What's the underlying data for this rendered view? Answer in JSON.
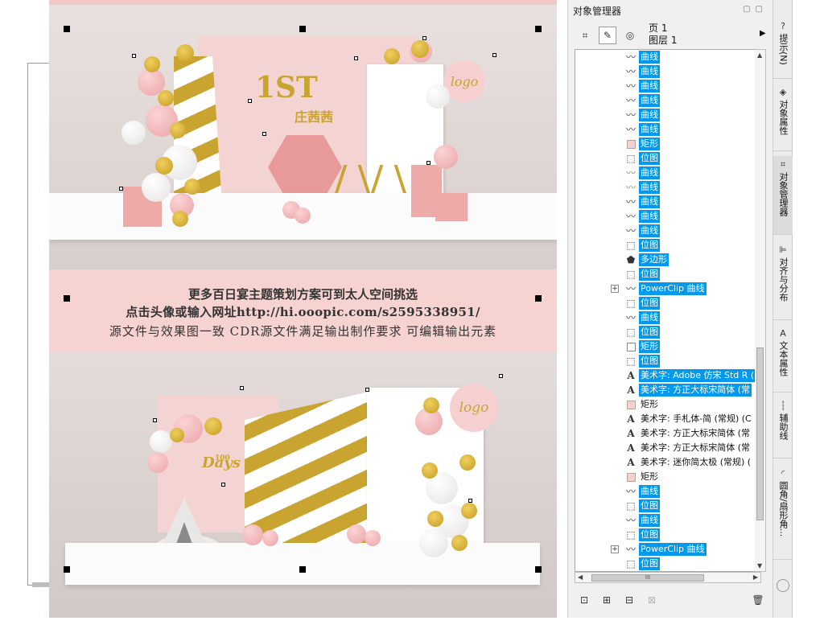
{
  "canvas": {
    "banner": {
      "line1": "更多百日宴主题策划方案可到太人空间挑选",
      "line2": "点击头像或输入网址http://hi.ooopic.com/s2595338951/",
      "line3": "源文件与效果图一致 CDR源文件满足输出制作要求 可编辑输出元素"
    },
    "top_scene": {
      "title": "1ST",
      "name": "庄茜茜",
      "logo_text": "logo"
    },
    "bottom_scene": {
      "days_number": "100",
      "days_text": "Days",
      "logo_text": "logo"
    }
  },
  "docker": {
    "title": "对象管理器",
    "page_label": "页 1",
    "layer_label": "图层 1",
    "toolbar": [
      {
        "name": "show-properties-button",
        "icon": "properties-icon",
        "glyph": "⌗"
      },
      {
        "name": "edit-across-layers-button",
        "icon": "edit-layers-icon",
        "glyph": "✎"
      },
      {
        "name": "layer-manager-view-button",
        "icon": "layer-view-icon",
        "glyph": "◎"
      }
    ],
    "tree_items": [
      {
        "icon": "curve",
        "label": "曲线",
        "selected": true,
        "expander": false
      },
      {
        "icon": "curve",
        "label": "曲线",
        "selected": true,
        "expander": false
      },
      {
        "icon": "curve",
        "label": "曲线",
        "selected": true,
        "expander": false
      },
      {
        "icon": "curve",
        "label": "曲线",
        "selected": true,
        "expander": false
      },
      {
        "icon": "curve",
        "label": "曲线",
        "selected": true,
        "expander": false
      },
      {
        "icon": "curve",
        "label": "曲线",
        "selected": true,
        "expander": false
      },
      {
        "icon": "rect",
        "label": "矩形",
        "selected": true,
        "expander": false
      },
      {
        "icon": "bitmap",
        "label": "位图",
        "selected": true,
        "expander": false
      },
      {
        "icon": "curve-gold",
        "label": "曲线",
        "selected": true,
        "expander": false
      },
      {
        "icon": "curve-gold",
        "label": "曲线",
        "selected": true,
        "expander": false
      },
      {
        "icon": "curve",
        "label": "曲线",
        "selected": true,
        "expander": false
      },
      {
        "icon": "curve",
        "label": "曲线",
        "selected": true,
        "expander": false
      },
      {
        "icon": "curve",
        "label": "曲线",
        "selected": true,
        "expander": false
      },
      {
        "icon": "bitmap",
        "label": "位图",
        "selected": true,
        "expander": false
      },
      {
        "icon": "polygon",
        "label": "多边形",
        "selected": true,
        "expander": false
      },
      {
        "icon": "bitmap",
        "label": "位图",
        "selected": true,
        "expander": false
      },
      {
        "icon": "curve",
        "label": "PowerClip 曲线",
        "selected": true,
        "expander": true
      },
      {
        "icon": "bitmap",
        "label": "位图",
        "selected": true,
        "expander": false
      },
      {
        "icon": "curve",
        "label": "曲线",
        "selected": true,
        "expander": false
      },
      {
        "icon": "bitmap",
        "label": "位图",
        "selected": true,
        "expander": false
      },
      {
        "icon": "rect-empty",
        "label": "矩形",
        "selected": true,
        "expander": false
      },
      {
        "icon": "bitmap",
        "label": "位图",
        "selected": true,
        "expander": false
      },
      {
        "icon": "text",
        "label": "美术字: Adobe 仿宋 Std R (常",
        "selected": true,
        "expander": false
      },
      {
        "icon": "text",
        "label": "美术字: 方正大标宋简体 (常",
        "selected": true,
        "expander": false
      },
      {
        "icon": "rect",
        "label": "矩形",
        "selected": false,
        "expander": false
      },
      {
        "icon": "text",
        "label": "美术字: 手札体-简 (常规) (C",
        "selected": false,
        "expander": false
      },
      {
        "icon": "text",
        "label": "美术字: 方正大标宋简体 (常",
        "selected": false,
        "expander": false
      },
      {
        "icon": "text",
        "label": "美术字: 方正大标宋简体 (常",
        "selected": false,
        "expander": false
      },
      {
        "icon": "text",
        "label": "美术字: 迷你简太极 (常规) (",
        "selected": false,
        "expander": false
      },
      {
        "icon": "rect",
        "label": "矩形",
        "selected": false,
        "expander": false
      },
      {
        "icon": "curve",
        "label": "曲线",
        "selected": true,
        "expander": false
      },
      {
        "icon": "bitmap",
        "label": "位图",
        "selected": true,
        "expander": false
      },
      {
        "icon": "curve",
        "label": "曲线",
        "selected": true,
        "expander": false
      },
      {
        "icon": "bitmap",
        "label": "位图",
        "selected": true,
        "expander": false
      },
      {
        "icon": "curve",
        "label": "PowerClip 曲线",
        "selected": true,
        "expander": true
      },
      {
        "icon": "bitmap",
        "label": "位图",
        "selected": true,
        "expander": false
      }
    ],
    "bottom_buttons": [
      {
        "name": "new-layer-button",
        "glyph": "⊡",
        "disabled": false
      },
      {
        "name": "new-master-layer-button",
        "glyph": "⊞",
        "disabled": false
      },
      {
        "name": "new-master-layer-all-pages-button",
        "glyph": "⊟",
        "disabled": false
      },
      {
        "name": "new-master-layer-even-button",
        "glyph": "⊠",
        "disabled": true
      },
      {
        "name": "delete-button",
        "glyph": "🗑",
        "disabled": false
      }
    ]
  },
  "side_tabs": [
    {
      "name": "tab-hints",
      "icon": "hints-icon",
      "glyph": "?",
      "label": "提示(N)"
    },
    {
      "name": "tab-object-properties",
      "icon": "object-properties-icon",
      "glyph": "◈",
      "label": "对象属性"
    },
    {
      "name": "tab-object-manager",
      "icon": "object-manager-icon",
      "glyph": "⌗",
      "label": "对象管理器",
      "active": true
    },
    {
      "name": "tab-align-distribute",
      "icon": "align-icon",
      "glyph": "⊫",
      "label": "对齐与分布"
    },
    {
      "name": "tab-text-properties",
      "icon": "text-properties-icon",
      "glyph": "A",
      "label": "文本属性"
    },
    {
      "name": "tab-guidelines",
      "icon": "guidelines-icon",
      "glyph": "┆",
      "label": "辅助线"
    },
    {
      "name": "tab-fillet",
      "icon": "fillet-icon",
      "glyph": "◜",
      "label": "圆角/扇形角..."
    }
  ]
}
